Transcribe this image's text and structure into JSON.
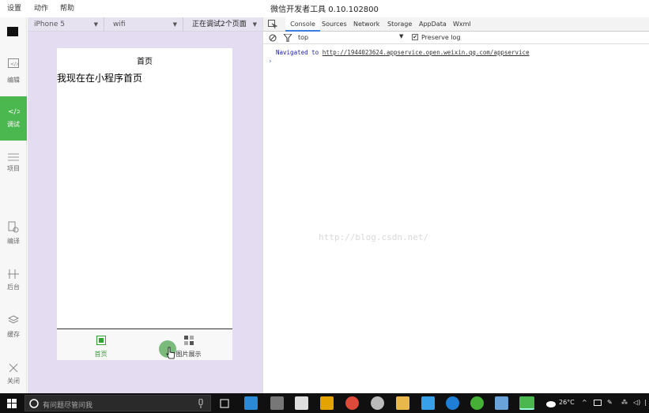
{
  "menu": {
    "items": [
      "设置",
      "动作",
      "帮助"
    ]
  },
  "app": {
    "title": "微信开发者工具 0.10.102800"
  },
  "sidebar": {
    "items": [
      {
        "label": "",
        "icon": "avatar-icon"
      },
      {
        "label": "编辑",
        "icon": "code-file-icon"
      },
      {
        "label": "调试",
        "icon": "debug-code-icon",
        "active": true
      },
      {
        "label": "项目",
        "icon": "menu-lines-icon"
      },
      {
        "label": "编译",
        "icon": "compile-icon"
      },
      {
        "label": "后台",
        "icon": "background-icon"
      },
      {
        "label": "缓存",
        "icon": "layers-icon"
      },
      {
        "label": "关闭",
        "icon": "close-icon"
      }
    ]
  },
  "device_bar": {
    "device": "iPhone 5",
    "network": "wifi",
    "debug_pages": "正在调试2个页面"
  },
  "simulator": {
    "nav_title": "首页",
    "page_text": "我现在在小程序首页",
    "tabs": [
      {
        "label": "首页",
        "icon": "home-tab-icon",
        "active": true,
        "color": "#2fa32f"
      },
      {
        "label": "图片展示",
        "icon": "grid-tab-icon",
        "active": false,
        "color": "#333333"
      }
    ]
  },
  "devtools": {
    "tabs": [
      "Console",
      "Sources",
      "Network",
      "Storage",
      "AppData",
      "Wxml"
    ],
    "active_tab": "Console",
    "filter": {
      "context": "top",
      "preserve_log_label": "Preserve log",
      "preserve_log_checked": true
    },
    "console": {
      "navigated_prefix": "Navigated to",
      "navigated_url": "http://1944023624.appservice.open.weixin.qq.com/appservice",
      "prompt": "›"
    },
    "watermark": "http://blog.csdn.net/"
  },
  "taskbar": {
    "search_placeholder": "有问题尽管问我",
    "weather": "26°C",
    "colors": {
      "accent": "#4bb84f",
      "bar": "#101010"
    }
  }
}
